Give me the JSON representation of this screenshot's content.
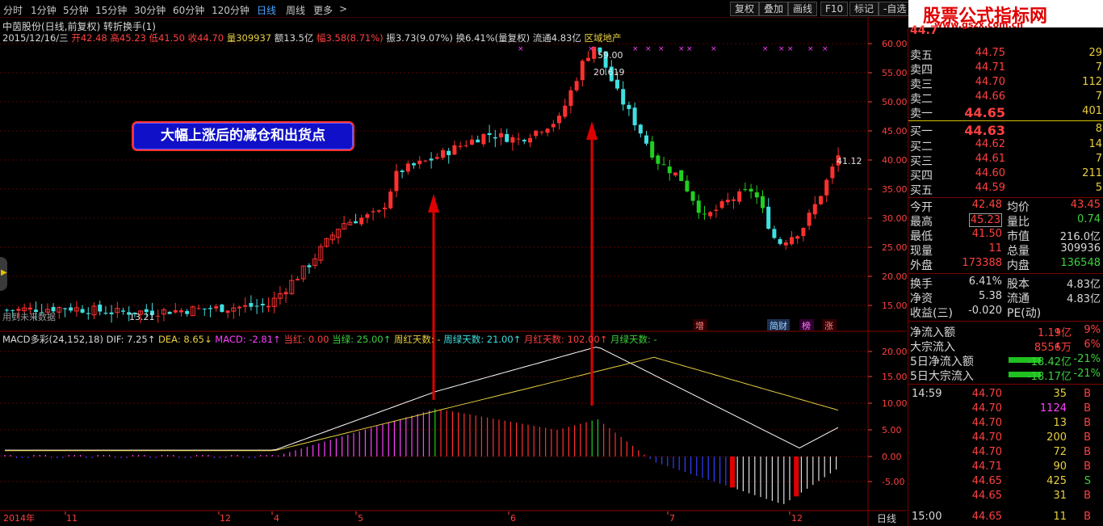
{
  "toolbar": {
    "periods": [
      "分时",
      "1分钟",
      "5分钟",
      "15分钟",
      "30分钟",
      "60分钟",
      "120分钟",
      "日线",
      "周线",
      "更多"
    ],
    "active_period": "日线",
    "more_arrow": ">",
    "tools": [
      "复权",
      "叠加",
      "画线",
      "F10",
      "标记",
      "-自选"
    ]
  },
  "logo": {
    "title": "股票公式指标网",
    "url": "www.gszx.com.cn"
  },
  "stock_info": {
    "name_line": "中茵股份(日线,前复权) 转折换手(1)",
    "date": "2015/12/16/三",
    "open_label": "开",
    "open": "42.48",
    "high_label": "高",
    "high": "45.23",
    "low_label": "低",
    "low": "41.50",
    "close_label": "收",
    "close": "44.70",
    "vol_label": "量",
    "vol": "309937",
    "amount_label": "额",
    "amount": "13.5亿",
    "change_label": "幅",
    "change": "3.58(8.71%)",
    "amp_label": "振",
    "amp": "3.73(9.07%)",
    "turnover_label": "换",
    "turnover": "6.41%(量复权)",
    "float_label": "流通",
    "float": "4.83亿",
    "sector": "区域地产"
  },
  "annotation": "大幅上涨后的减仓和出货点",
  "price_chart": {
    "marks": {
      "high": "59.00",
      "mid": "20.619",
      "low": "13.21",
      "last": "41.12"
    },
    "badges": [
      "增",
      "简财",
      "榜",
      "涨"
    ],
    "future_label": "用到未来数据",
    "y_ticks": [
      "60.00",
      "55.00",
      "50.00",
      "45.00",
      "40.00",
      "35.00",
      "30.00",
      "25.00",
      "20.00",
      "15.00"
    ]
  },
  "macd_panel": {
    "name": "MACD多彩(24,152,18)",
    "dif": "DIF: 7.25↑",
    "dea": "DEA: 8.65↓",
    "macd": "MACD: -2.81↑",
    "cur_red": "当红: 0.00",
    "cur_green": "当绿: 25.00↑",
    "week_red": "周红天数: -",
    "week_green": "周绿天数: 21.00↑",
    "month_red": "月红天数: 102.00↑",
    "month_green": "月绿天数: -",
    "y_ticks": [
      "20.00",
      "15.00",
      "10.00",
      "5.00",
      "0.00",
      "-5.00"
    ]
  },
  "x_axis": {
    "labels": [
      "2014年",
      "11",
      "12",
      "4",
      "5",
      "6",
      "7",
      "12"
    ],
    "period_label": "日线"
  },
  "order_book": {
    "sells": [
      {
        "label": "卖五",
        "price": "44.75",
        "vol": "29"
      },
      {
        "label": "卖四",
        "price": "44.71",
        "vol": "7"
      },
      {
        "label": "卖三",
        "price": "44.70",
        "vol": "112"
      },
      {
        "label": "卖二",
        "price": "44.66",
        "vol": "7"
      },
      {
        "label": "卖一",
        "price": "44.65",
        "vol": "401"
      }
    ],
    "buys": [
      {
        "label": "买一",
        "price": "44.63",
        "vol": "8"
      },
      {
        "label": "买二",
        "price": "44.62",
        "vol": "14"
      },
      {
        "label": "买三",
        "price": "44.61",
        "vol": "7"
      },
      {
        "label": "买四",
        "price": "44.60",
        "vol": "211"
      },
      {
        "label": "买五",
        "price": "44.59",
        "vol": "5"
      }
    ],
    "top_price": "44.7"
  },
  "quote": {
    "open_label": "今开",
    "open": "42.48",
    "avg_label": "均价",
    "avg": "43.45",
    "high_label": "最高",
    "high": "45.23",
    "ratio_label": "量比",
    "ratio": "0.74",
    "low_label": "最低",
    "low": "41.50",
    "mcap_label": "市值",
    "mcap": "216.0亿",
    "cur_label": "现量",
    "cur": "11",
    "total_label": "总量",
    "total": "309936",
    "out_label": "外盘",
    "out": "173388",
    "in_label": "内盘",
    "in": "136548",
    "turn_label": "换手",
    "turn": "6.41%",
    "cap_label": "股本",
    "cap": "4.83亿",
    "nav_label": "净资",
    "nav": "5.38",
    "flt_label": "流通",
    "flt": "4.83亿",
    "eps_label": "收益(三)",
    "eps": "-0.020",
    "pe_label": "PE(动)",
    "pe": ""
  },
  "fund_flow": [
    {
      "label": "净流入额",
      "value": "1.19亿",
      "pct": "9%"
    },
    {
      "label": "大宗流入",
      "value": "8556万",
      "pct": "6%"
    },
    {
      "label": "5日净流入额",
      "value": "-18.42亿",
      "pct": "-21%"
    },
    {
      "label": "5日大宗流入",
      "value": "-18.17亿",
      "pct": "-21%"
    }
  ],
  "ticks": [
    {
      "time": "14:59",
      "price": "44.70",
      "vol": "35",
      "side": "B"
    },
    {
      "time": "",
      "price": "44.70",
      "vol": "1124",
      "side": "B"
    },
    {
      "time": "",
      "price": "44.70",
      "vol": "13",
      "side": "B"
    },
    {
      "time": "",
      "price": "44.70",
      "vol": "200",
      "side": "B"
    },
    {
      "time": "",
      "price": "44.70",
      "vol": "72",
      "side": "B"
    },
    {
      "time": "",
      "price": "44.71",
      "vol": "90",
      "side": "B"
    },
    {
      "time": "",
      "price": "44.65",
      "vol": "425",
      "side": "S"
    },
    {
      "time": "",
      "price": "44.65",
      "vol": "31",
      "side": "B"
    },
    {
      "time": "15:00",
      "price": "44.65",
      "vol": "11",
      "side": "B"
    }
  ],
  "colors": {
    "up": "#ff3030",
    "down": "#40e0e0",
    "green": "#20c020",
    "dif": "#ffffff",
    "dea": "#e8d040"
  }
}
